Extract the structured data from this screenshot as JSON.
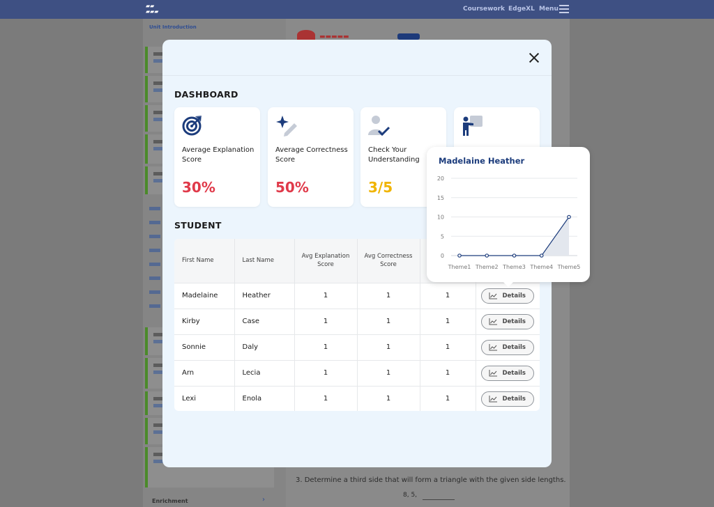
{
  "background": {
    "nav": [
      "Coursework",
      "EdgeXL",
      "Menu"
    ],
    "unit_intro": "Unit Introduction",
    "question": "3.  Determine a third side that will form a triangle with the given side lengths.",
    "question_values": "8, 5,",
    "enrichment": "Enrichment"
  },
  "modal": {
    "dashboard_title": "DASHBOARD",
    "student_title": "STUDENT",
    "cards": [
      {
        "label": "Average Explanation Score",
        "value": "30%",
        "color": "#e03a4a",
        "icon": "target-icon"
      },
      {
        "label": "Average Correctness Score",
        "value": "50%",
        "color": "#e03a4a",
        "icon": "sparkle-pencil-icon"
      },
      {
        "label": "Check Your Understanding",
        "value": "3/5",
        "color": "#f0b400",
        "icon": "person-check-icon"
      },
      {
        "label": "",
        "value": "",
        "color": "#1c3c7c",
        "icon": "presenter-icon"
      }
    ],
    "table": {
      "headers": [
        "First Name",
        "Last Name",
        "Avg Explanation Score",
        "Avg Correctness Score",
        "",
        ""
      ],
      "details_label": "Details",
      "rows": [
        {
          "first": "Madelaine",
          "last": "Heather",
          "exp": "1",
          "cor": "1",
          "cyu": "1"
        },
        {
          "first": "Kirby",
          "last": "Case",
          "exp": "1",
          "cor": "1",
          "cyu": "1"
        },
        {
          "first": "Sonnie",
          "last": "Daly",
          "exp": "1",
          "cor": "1",
          "cyu": "1"
        },
        {
          "first": "Arn",
          "last": "Lecia",
          "exp": "1",
          "cor": "1",
          "cyu": "1"
        },
        {
          "first": "Lexi",
          "last": "Enola",
          "exp": "1",
          "cor": "1",
          "cyu": "1"
        }
      ]
    }
  },
  "popover": {
    "title": "Madelaine Heather"
  },
  "chart_data": {
    "type": "area",
    "title": "Madelaine Heather",
    "categories": [
      "Theme1",
      "Theme2",
      "Theme3",
      "Theme4",
      "Theme5"
    ],
    "values": [
      0,
      0,
      0,
      0,
      10
    ],
    "ylim": [
      0,
      20
    ],
    "yticks": [
      0,
      5,
      10,
      15,
      20
    ],
    "grid": true,
    "color": "#1c3c7c"
  }
}
